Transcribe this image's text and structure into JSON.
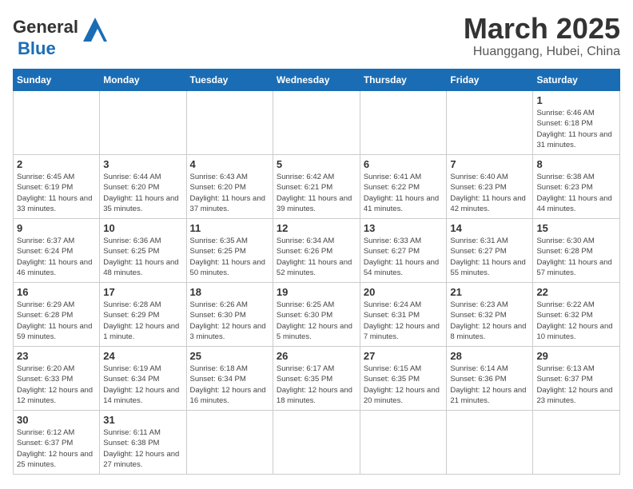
{
  "logo": {
    "text_general": "General",
    "text_blue": "Blue"
  },
  "title": {
    "month_year": "March 2025",
    "location": "Huanggang, Hubei, China"
  },
  "days_of_week": [
    "Sunday",
    "Monday",
    "Tuesday",
    "Wednesday",
    "Thursday",
    "Friday",
    "Saturday"
  ],
  "weeks": [
    [
      {
        "day": "",
        "info": ""
      },
      {
        "day": "",
        "info": ""
      },
      {
        "day": "",
        "info": ""
      },
      {
        "day": "",
        "info": ""
      },
      {
        "day": "",
        "info": ""
      },
      {
        "day": "",
        "info": ""
      },
      {
        "day": "1",
        "info": "Sunrise: 6:46 AM\nSunset: 6:18 PM\nDaylight: 11 hours\nand 31 minutes."
      }
    ],
    [
      {
        "day": "2",
        "info": "Sunrise: 6:45 AM\nSunset: 6:19 PM\nDaylight: 11 hours\nand 33 minutes."
      },
      {
        "day": "3",
        "info": "Sunrise: 6:44 AM\nSunset: 6:20 PM\nDaylight: 11 hours\nand 35 minutes."
      },
      {
        "day": "4",
        "info": "Sunrise: 6:43 AM\nSunset: 6:20 PM\nDaylight: 11 hours\nand 37 minutes."
      },
      {
        "day": "5",
        "info": "Sunrise: 6:42 AM\nSunset: 6:21 PM\nDaylight: 11 hours\nand 39 minutes."
      },
      {
        "day": "6",
        "info": "Sunrise: 6:41 AM\nSunset: 6:22 PM\nDaylight: 11 hours\nand 41 minutes."
      },
      {
        "day": "7",
        "info": "Sunrise: 6:40 AM\nSunset: 6:23 PM\nDaylight: 11 hours\nand 42 minutes."
      },
      {
        "day": "8",
        "info": "Sunrise: 6:38 AM\nSunset: 6:23 PM\nDaylight: 11 hours\nand 44 minutes."
      }
    ],
    [
      {
        "day": "9",
        "info": "Sunrise: 6:37 AM\nSunset: 6:24 PM\nDaylight: 11 hours\nand 46 minutes."
      },
      {
        "day": "10",
        "info": "Sunrise: 6:36 AM\nSunset: 6:25 PM\nDaylight: 11 hours\nand 48 minutes."
      },
      {
        "day": "11",
        "info": "Sunrise: 6:35 AM\nSunset: 6:25 PM\nDaylight: 11 hours\nand 50 minutes."
      },
      {
        "day": "12",
        "info": "Sunrise: 6:34 AM\nSunset: 6:26 PM\nDaylight: 11 hours\nand 52 minutes."
      },
      {
        "day": "13",
        "info": "Sunrise: 6:33 AM\nSunset: 6:27 PM\nDaylight: 11 hours\nand 54 minutes."
      },
      {
        "day": "14",
        "info": "Sunrise: 6:31 AM\nSunset: 6:27 PM\nDaylight: 11 hours\nand 55 minutes."
      },
      {
        "day": "15",
        "info": "Sunrise: 6:30 AM\nSunset: 6:28 PM\nDaylight: 11 hours\nand 57 minutes."
      }
    ],
    [
      {
        "day": "16",
        "info": "Sunrise: 6:29 AM\nSunset: 6:28 PM\nDaylight: 11 hours\nand 59 minutes."
      },
      {
        "day": "17",
        "info": "Sunrise: 6:28 AM\nSunset: 6:29 PM\nDaylight: 12 hours\nand 1 minute."
      },
      {
        "day": "18",
        "info": "Sunrise: 6:26 AM\nSunset: 6:30 PM\nDaylight: 12 hours\nand 3 minutes."
      },
      {
        "day": "19",
        "info": "Sunrise: 6:25 AM\nSunset: 6:30 PM\nDaylight: 12 hours\nand 5 minutes."
      },
      {
        "day": "20",
        "info": "Sunrise: 6:24 AM\nSunset: 6:31 PM\nDaylight: 12 hours\nand 7 minutes."
      },
      {
        "day": "21",
        "info": "Sunrise: 6:23 AM\nSunset: 6:32 PM\nDaylight: 12 hours\nand 8 minutes."
      },
      {
        "day": "22",
        "info": "Sunrise: 6:22 AM\nSunset: 6:32 PM\nDaylight: 12 hours\nand 10 minutes."
      }
    ],
    [
      {
        "day": "23",
        "info": "Sunrise: 6:20 AM\nSunset: 6:33 PM\nDaylight: 12 hours\nand 12 minutes."
      },
      {
        "day": "24",
        "info": "Sunrise: 6:19 AM\nSunset: 6:34 PM\nDaylight: 12 hours\nand 14 minutes."
      },
      {
        "day": "25",
        "info": "Sunrise: 6:18 AM\nSunset: 6:34 PM\nDaylight: 12 hours\nand 16 minutes."
      },
      {
        "day": "26",
        "info": "Sunrise: 6:17 AM\nSunset: 6:35 PM\nDaylight: 12 hours\nand 18 minutes."
      },
      {
        "day": "27",
        "info": "Sunrise: 6:15 AM\nSunset: 6:35 PM\nDaylight: 12 hours\nand 20 minutes."
      },
      {
        "day": "28",
        "info": "Sunrise: 6:14 AM\nSunset: 6:36 PM\nDaylight: 12 hours\nand 21 minutes."
      },
      {
        "day": "29",
        "info": "Sunrise: 6:13 AM\nSunset: 6:37 PM\nDaylight: 12 hours\nand 23 minutes."
      }
    ],
    [
      {
        "day": "30",
        "info": "Sunrise: 6:12 AM\nSunset: 6:37 PM\nDaylight: 12 hours\nand 25 minutes."
      },
      {
        "day": "31",
        "info": "Sunrise: 6:11 AM\nSunset: 6:38 PM\nDaylight: 12 hours\nand 27 minutes."
      },
      {
        "day": "",
        "info": ""
      },
      {
        "day": "",
        "info": ""
      },
      {
        "day": "",
        "info": ""
      },
      {
        "day": "",
        "info": ""
      },
      {
        "day": "",
        "info": ""
      }
    ]
  ]
}
